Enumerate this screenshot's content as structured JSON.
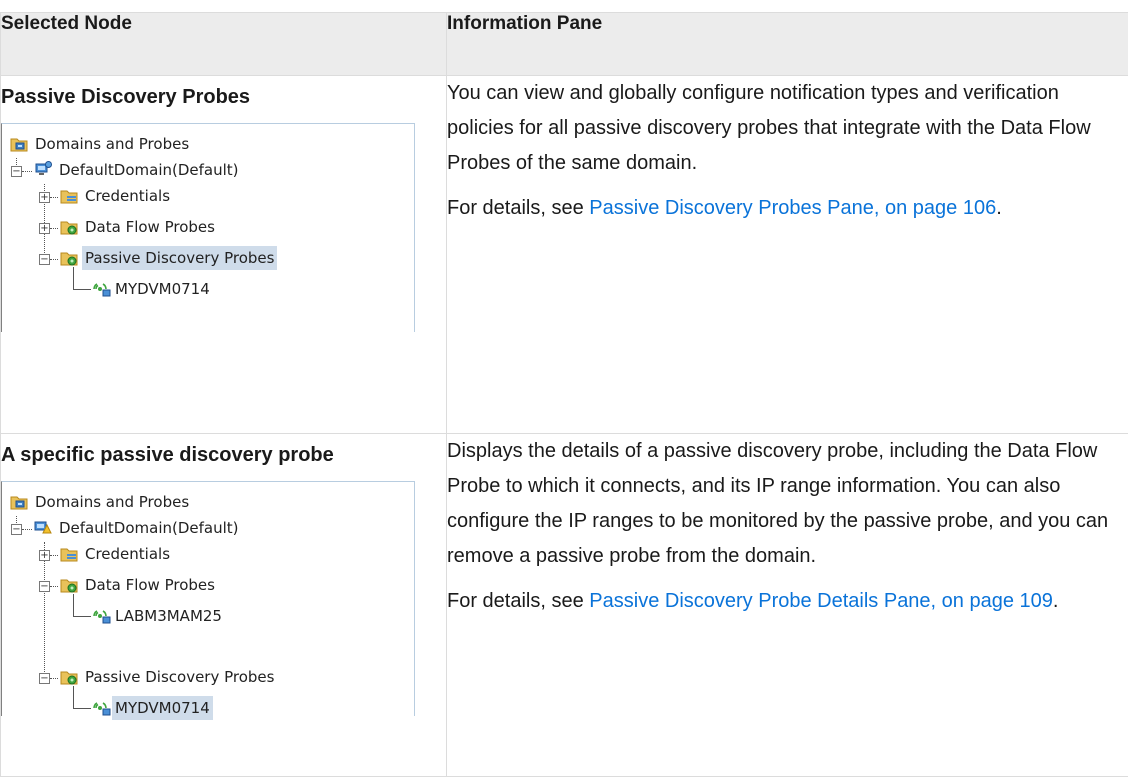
{
  "headers": {
    "col1": "Selected Node",
    "col2": "Information Pane"
  },
  "rows": [
    {
      "node_title": "Passive Discovery Probes",
      "tree": {
        "root": "Domains and Probes",
        "domain": "DefaultDomain(Default)",
        "credentials": "Credentials",
        "data_flow": "Data Flow Probes",
        "passive": "Passive Discovery Probes",
        "probe": "MYDVM0714"
      },
      "para1": "You can view and globally configure notification types and verification policies for all passive discovery probes that integrate with the Data Flow Probes of the same domain.",
      "para2_prefix": "For details, see ",
      "para2_link": "Passive Discovery Probes Pane, on page 106",
      "para2_suffix": "."
    },
    {
      "node_title": "A specific passive discovery probe",
      "tree": {
        "root": "Domains and Probes",
        "domain": "DefaultDomain(Default)",
        "credentials": "Credentials",
        "data_flow": "Data Flow Probes",
        "dfp_child": "LABM3MAM25",
        "passive": "Passive Discovery Probes",
        "probe": "MYDVM0714"
      },
      "para1": "Displays the details of a passive discovery probe, including the Data Flow Probe to which it connects, and its IP range information. You can also configure the IP ranges to be monitored by the passive probe, and you can remove a passive probe from the domain.",
      "para2_prefix": "For details, see ",
      "para2_link": "Passive Discovery Probe Details Pane, on page 109",
      "para2_suffix": "."
    }
  ],
  "colors": {
    "link": "#0a73d9",
    "header_bg": "#ececec",
    "selection": "#cfdcea"
  }
}
